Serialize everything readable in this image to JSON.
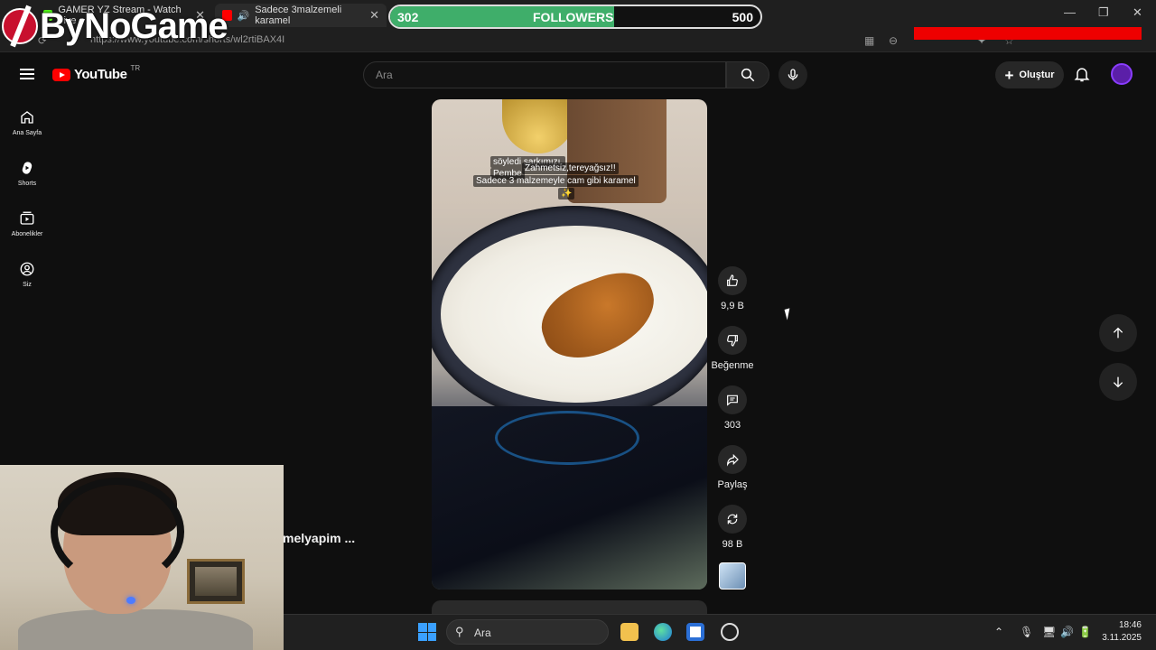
{
  "browser": {
    "tabs": [
      {
        "title": "GAMER YZ Stream - Watch Live o",
        "favicon_color": "#53fc18"
      },
      {
        "title": "Sadece 3malzemeli karamel",
        "favicon_color": "#ff0000"
      }
    ],
    "url": "https://www.youtube.com/shorts/wl2rtiBAX4I"
  },
  "overlay": {
    "logo_text": "ByNoGame",
    "followers": {
      "current": "302",
      "label": "FOLLOWERS",
      "goal": "500",
      "progress": 0.604
    }
  },
  "header": {
    "brand": "YouTube",
    "region": "TR",
    "search_placeholder": "Ara",
    "create_label": "Oluştur"
  },
  "sidebar": {
    "items": [
      {
        "label": "Ana Sayfa",
        "icon": "home-icon"
      },
      {
        "label": "Shorts",
        "icon": "shorts-icon"
      },
      {
        "label": "Abonelikler",
        "icon": "subscriptions-icon"
      },
      {
        "label": "Siz",
        "icon": "account-icon"
      }
    ]
  },
  "short": {
    "captions": [
      "söyledi şarkımızı.",
      "Pembe",
      "Zahmetsiz,tereyağsız!!",
      "Sadece 3 malzemeyle cam gibi karamel",
      "✨"
    ],
    "channel": "melyapim ...",
    "actions": {
      "like_count": "9,9 B",
      "dislike_label": "Beğenme",
      "comment_count": "303",
      "share_label": "Paylaş",
      "remix_count": "98 B"
    }
  },
  "taskbar": {
    "search_label": "Ara",
    "time": "18:46",
    "date": "3.11.2025"
  }
}
